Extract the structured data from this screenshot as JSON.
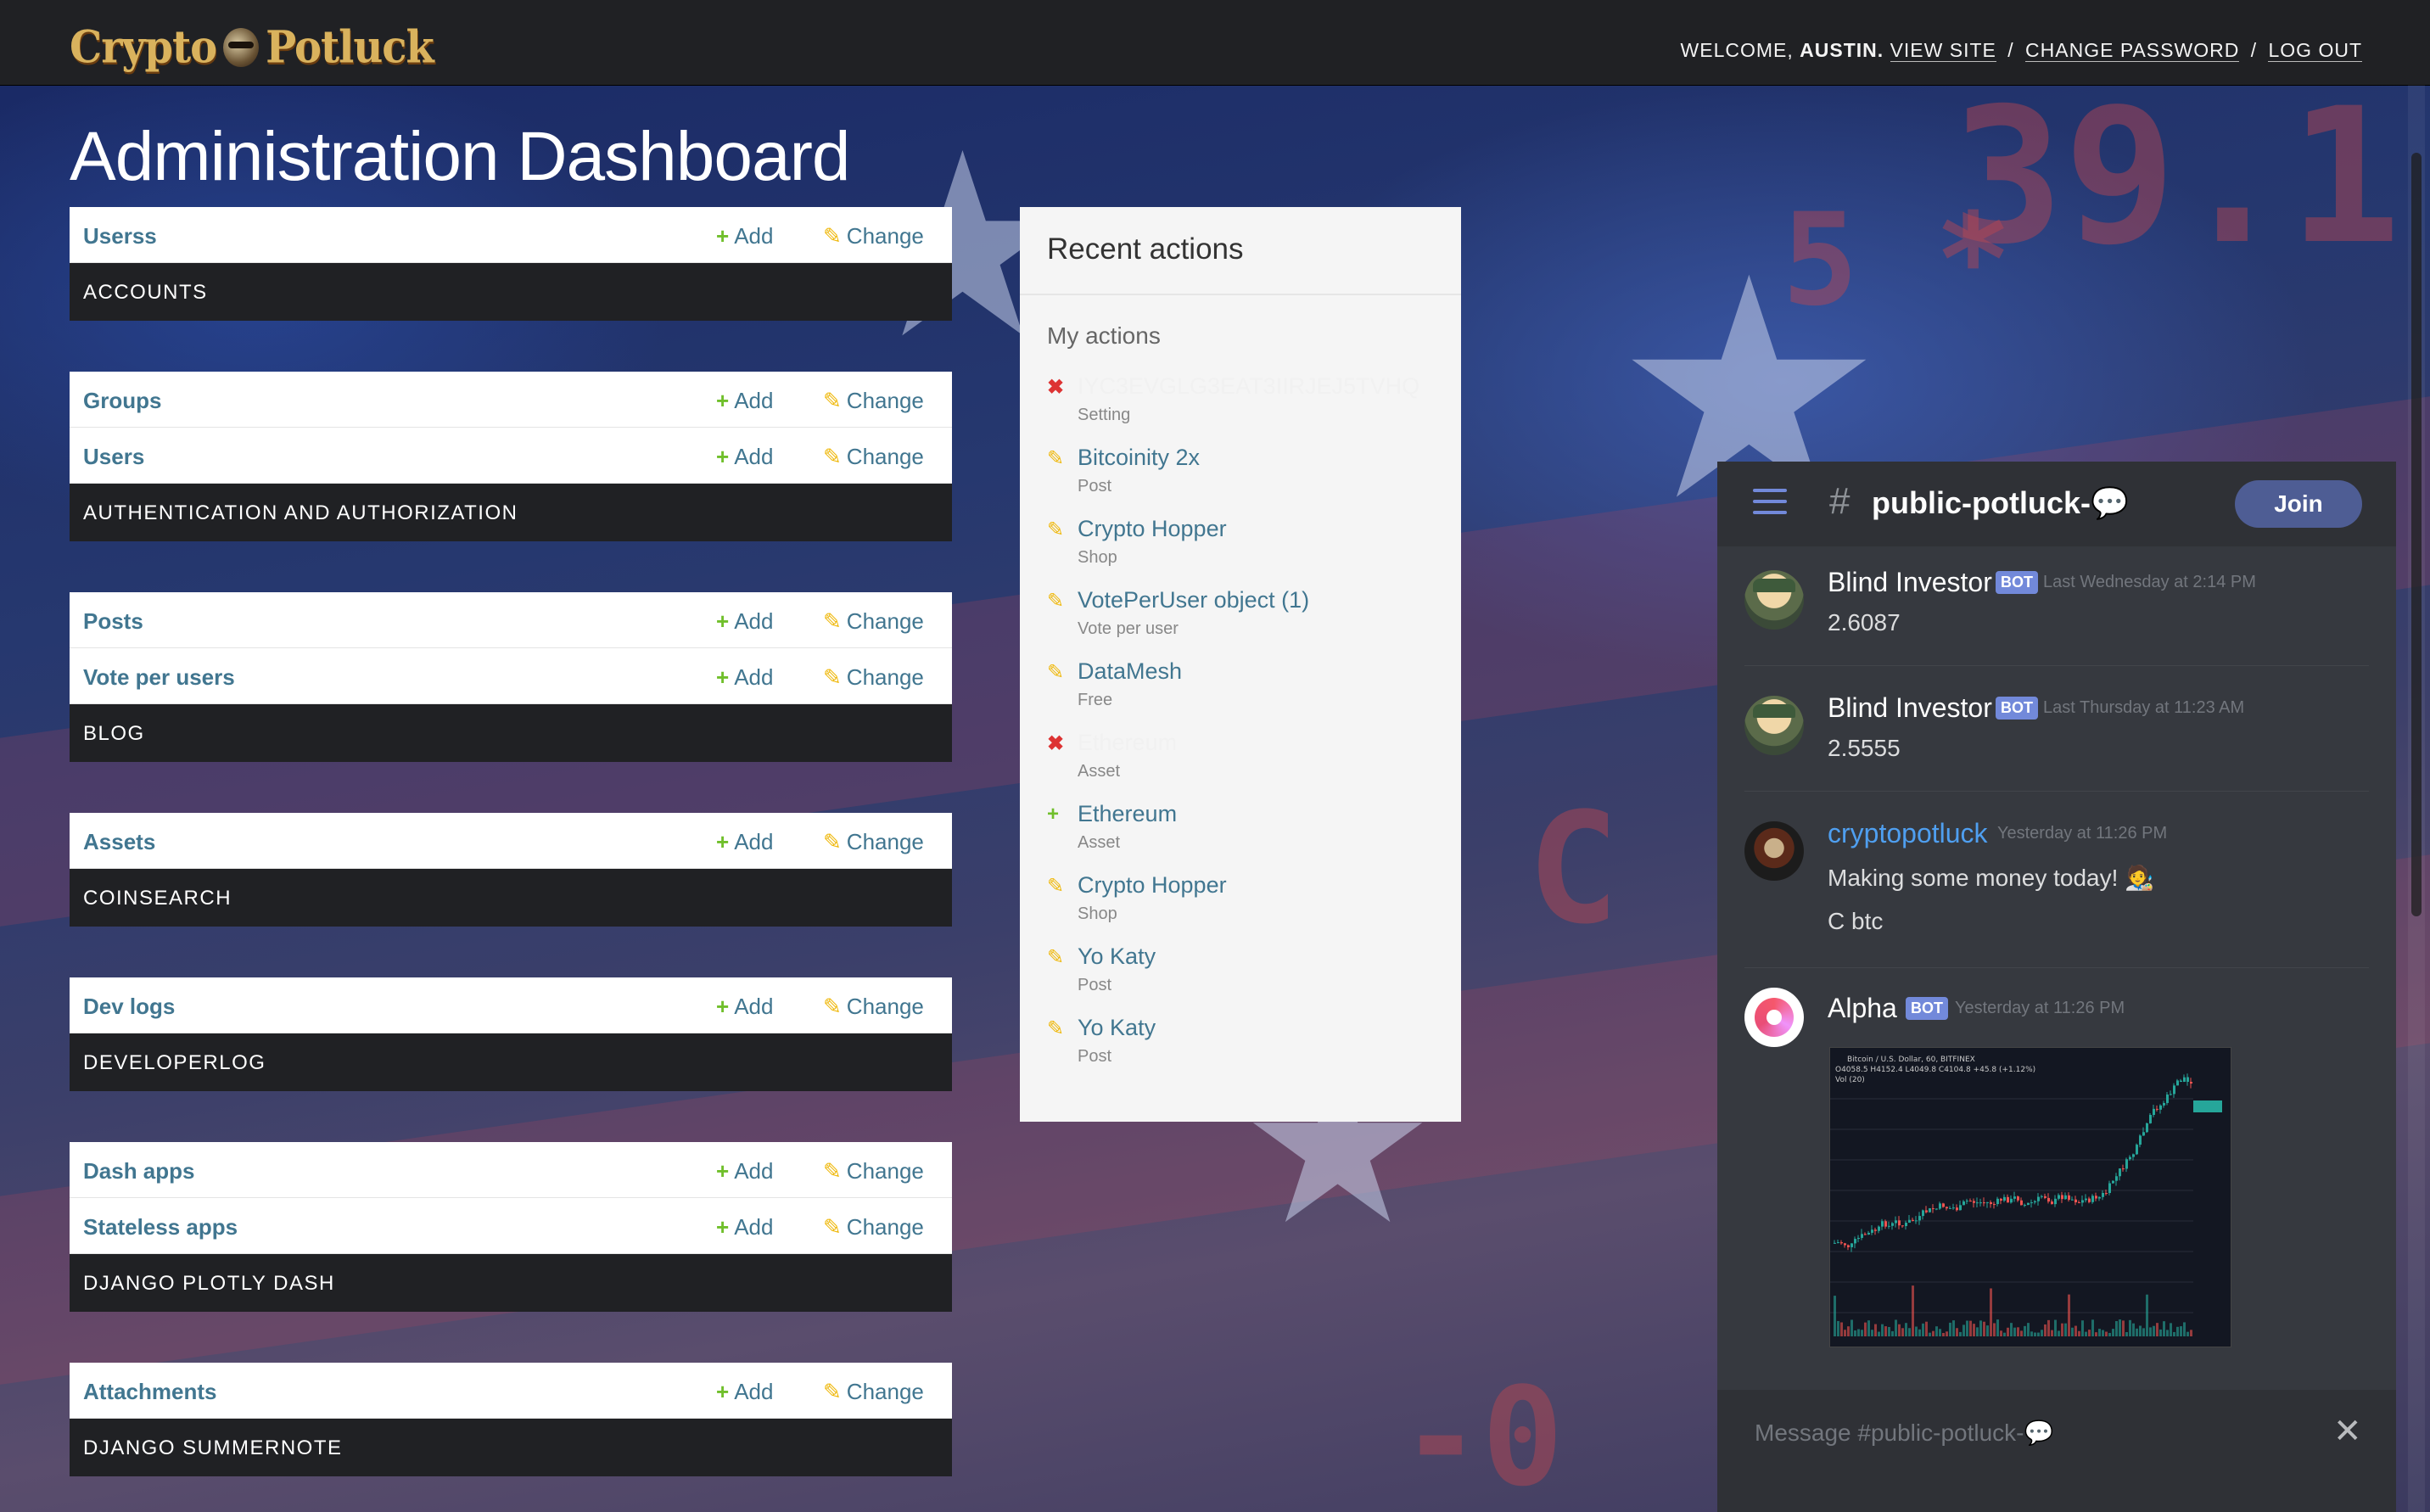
{
  "header": {
    "logo_text_left": "Crypto",
    "logo_text_right": "Potluck",
    "welcome_prefix": "WELCOME,",
    "username": "AUSTIN.",
    "view_site": "VIEW SITE",
    "change_password": "CHANGE PASSWORD",
    "log_out": "LOG OUT",
    "separator": "/"
  },
  "page_title": "Administration Dashboard",
  "labels": {
    "add": "Add",
    "change": "Change"
  },
  "modules": [
    {
      "caption": "ACCOUNTS",
      "models": [
        "Userss"
      ]
    },
    {
      "caption": "AUTHENTICATION AND AUTHORIZATION",
      "models": [
        "Groups",
        "Users"
      ]
    },
    {
      "caption": "BLOG",
      "models": [
        "Posts",
        "Vote per users"
      ]
    },
    {
      "caption": "COINSEARCH",
      "models": [
        "Assets"
      ]
    },
    {
      "caption": "DEVELOPERLOG",
      "models": [
        "Dev logs"
      ]
    },
    {
      "caption": "DJANGO PLOTLY DASH",
      "models": [
        "Dash apps",
        "Stateless apps"
      ]
    },
    {
      "caption": "DJANGO SUMMERNOTE",
      "models": [
        "Attachments"
      ]
    }
  ],
  "recent_actions": {
    "title": "Recent actions",
    "subtitle": "My actions",
    "items": [
      {
        "action": "delete",
        "title": "IYC3EVGLG3EAT3IIRJEJ5TVHQ",
        "type": "Setting"
      },
      {
        "action": "change",
        "title": "Bitcoinity 2x",
        "type": "Post"
      },
      {
        "action": "change",
        "title": "Crypto Hopper",
        "type": "Shop"
      },
      {
        "action": "change",
        "title": "VotePerUser object (1)",
        "type": "Vote per user"
      },
      {
        "action": "change",
        "title": "DataMesh",
        "type": "Free"
      },
      {
        "action": "delete",
        "title": "Ethereum",
        "type": "Asset"
      },
      {
        "action": "add",
        "title": "Ethereum",
        "type": "Asset"
      },
      {
        "action": "change",
        "title": "Crypto Hopper",
        "type": "Shop"
      },
      {
        "action": "change",
        "title": "Yo Katy",
        "type": "Post"
      },
      {
        "action": "change",
        "title": "Yo Katy",
        "type": "Post"
      }
    ]
  },
  "discord": {
    "channel": "public-potluck-💬",
    "join_label": "Join",
    "messages": [
      {
        "author": "Blind Investor",
        "bot": "BOT",
        "time": "Last Wednesday at 2:14 PM",
        "lines": [
          "2.6087"
        ]
      },
      {
        "author": "Blind Investor",
        "bot": "BOT",
        "time": "Last Thursday at 11:23 AM",
        "lines": [
          "2.5555"
        ]
      },
      {
        "author": "cryptopotluck",
        "time": "Yesterday at 11:26 PM",
        "lines": [
          "Making some money today! 🧑‍🎨",
          "C btc"
        ]
      },
      {
        "author": "Alpha",
        "bot": "BOT",
        "time": "Yesterday at 11:26 PM",
        "lines": []
      }
    ],
    "chart_header": "Bitcoin / U.S. Dollar, 60, BITFINEX",
    "chart_ohlc": "O4058.5 H4152.4 L4049.8 C4104.8 +45.8 (+1.12%)",
    "chart_vol": "Vol (20)",
    "composer_placeholder": "Message #public-potluck-💬"
  },
  "colors": {
    "link": "#417690",
    "add_icon": "#70bf2b",
    "change_icon": "#efb80b",
    "delete_icon": "#dd3333",
    "caption_bg": "#202124",
    "discord_bg": "#36393f",
    "discord_blurple": "#7289da"
  },
  "icons": {
    "add": "plus-icon",
    "change": "pencil-icon",
    "delete": "cross-icon"
  }
}
